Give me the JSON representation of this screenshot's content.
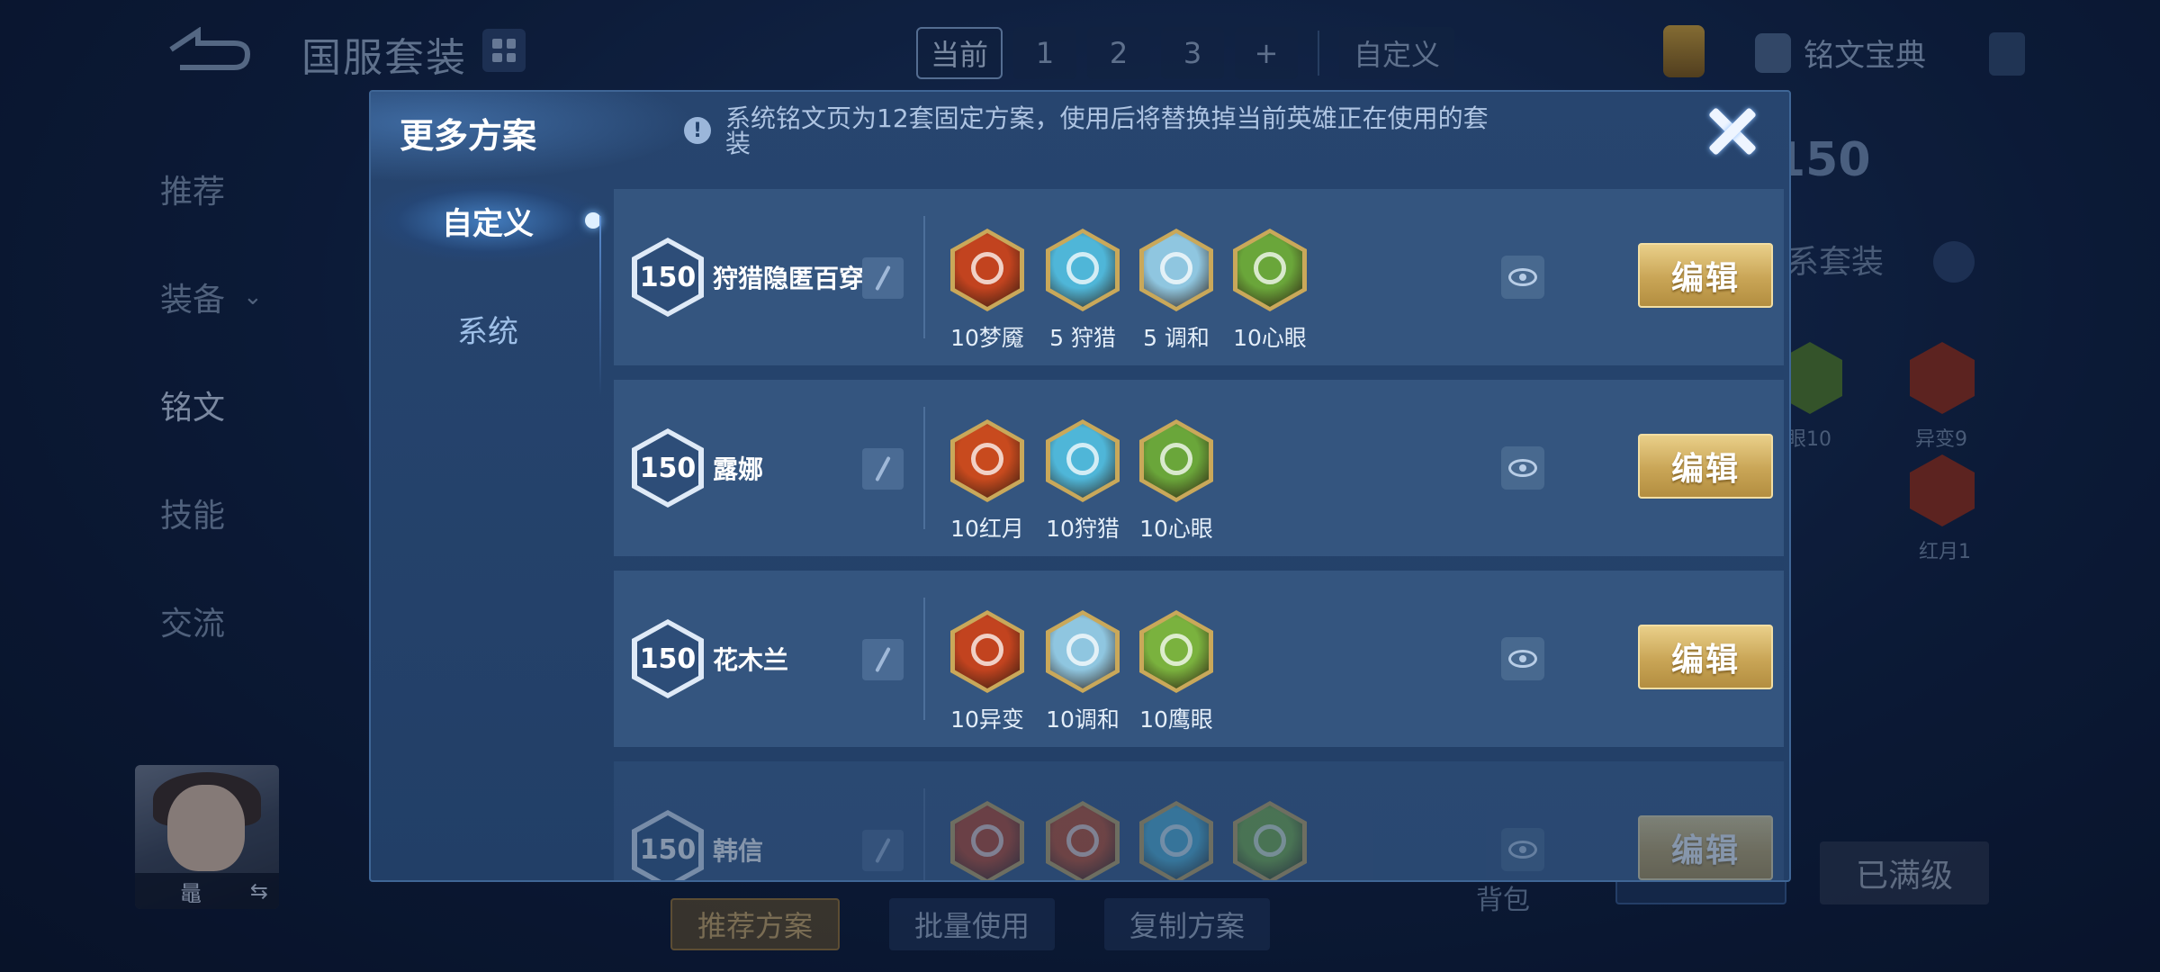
{
  "background": {
    "title": "国服套装",
    "plan_tabs": [
      "当前",
      "1",
      "2",
      "3",
      "+"
    ],
    "custom_tab": "自定义",
    "codex_label": "铭文宝典",
    "nav": [
      {
        "label": "推荐"
      },
      {
        "label": "装备",
        "chevron": "⌄"
      },
      {
        "label": "铭文"
      },
      {
        "label": "技能"
      },
      {
        "label": "交流"
      }
    ],
    "hero_name": "鼂",
    "swap_icon": "⇆",
    "bottom_buttons": [
      "推荐方案",
      "批量使用",
      "复制方案"
    ],
    "bag_label": "背包",
    "maxed_label": "已满级",
    "right_level": "150",
    "right_text": "系套装",
    "right_runes": [
      {
        "label": "眼10",
        "color": "#6a9a3a"
      },
      {
        "label": "异变9",
        "color": "#b03a2a"
      },
      {
        "label": "红月1",
        "color": "#b03a2a"
      }
    ]
  },
  "modal": {
    "title": "更多方案",
    "notice_icon": "!",
    "notice": "系统铭文页为12套固定方案，使用后将替换掉当前英雄正在使用的套装",
    "tabs": [
      "自定义",
      "系统"
    ],
    "active_tab": "自定义",
    "edit_label": "编辑",
    "rows": [
      {
        "level": "150",
        "name": "狩猎隐匿百穿",
        "runes": [
          {
            "label": "10梦魇",
            "color": "#c2431f"
          },
          {
            "label": "5 狩猎",
            "color": "#4fb6d8"
          },
          {
            "label": "5 调和",
            "color": "#8fc6e0"
          },
          {
            "label": "10心眼",
            "color": "#6aa63a"
          }
        ]
      },
      {
        "level": "150",
        "name": "露娜",
        "runes": [
          {
            "label": "10红月",
            "color": "#c84a1e"
          },
          {
            "label": "10狩猎",
            "color": "#4fb6d8"
          },
          {
            "label": "10心眼",
            "color": "#6aa63a"
          }
        ]
      },
      {
        "level": "150",
        "name": "花木兰",
        "runes": [
          {
            "label": "10异变",
            "color": "#c2431f"
          },
          {
            "label": "10调和",
            "color": "#8fc6e0"
          },
          {
            "label": "10鹰眼",
            "color": "#7ab23e"
          }
        ]
      },
      {
        "level": "150",
        "name": "韩信",
        "runes": [
          {
            "label": "",
            "color": "#c2431f"
          },
          {
            "label": "",
            "color": "#c84a1e"
          },
          {
            "label": "",
            "color": "#4fb6d8"
          },
          {
            "label": "",
            "color": "#7ab23e"
          }
        ]
      }
    ]
  }
}
